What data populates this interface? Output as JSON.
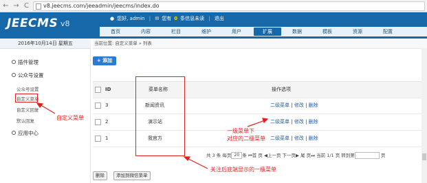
{
  "browser": {
    "back": "←",
    "forward": "→",
    "reload": "C",
    "url": "v8.jeecms.com/jeeadmin/jeecms/index.do"
  },
  "header": {
    "logo": "JEECMS",
    "version": "v8",
    "user": {
      "greeting": "您好, admin",
      "unread_prefix": "您有",
      "unread_count": "0",
      "unread_suffix": "条信息未读",
      "logout": "退出"
    },
    "nav": [
      "首页",
      "内容",
      "栏目",
      "维护",
      "用户",
      "扩展",
      "数据",
      "模板",
      "资源",
      "配置"
    ],
    "active_nav": "扩展"
  },
  "date": "2016年10月14日 星期五",
  "sidebar": {
    "groups": [
      {
        "label": "插件管理"
      },
      {
        "label": "公众号设置"
      },
      {
        "label": "应用中心"
      }
    ],
    "items": [
      "公众号设置",
      "自定义菜单",
      "自定义回复",
      "默认回复"
    ]
  },
  "breadcrumb": "当前位置: 自定义菜单 » 列表",
  "add_button": "+ 添加",
  "table": {
    "headers": {
      "id": "ID",
      "name": "菜单名称",
      "ops": "操作选项"
    },
    "rows": [
      {
        "id": "3",
        "name": "新闻资讯"
      },
      {
        "id": "2",
        "name": "演示站"
      },
      {
        "id": "1",
        "name": "我官方"
      }
    ],
    "ops": {
      "sub": "二级菜单",
      "sep": "|",
      "edit": "修改",
      "del": "删除"
    }
  },
  "pager": {
    "total": "共 3 条",
    "per_page": "每页",
    "per_page_value": "20",
    "per_page_unit": "条",
    "first": "首 页",
    "prev": "上一页",
    "next": "下一页",
    "last": "尾 页",
    "current": "当前 1/1 页",
    "goto": "转到第",
    "page_unit": "页"
  },
  "buttons": {
    "delete": "删除",
    "sync": "添加到微信菜单"
  },
  "annotations": {
    "custom_menu": "自定义菜单",
    "level1_line1": "一级菜单下",
    "level1_line2": "对应的二级菜单",
    "bottom": "关注后底端显示的一级菜单"
  },
  "colors": {
    "header": "#1668a8",
    "annotation": "#e02020",
    "link": "#1e5fb4",
    "add_button": "#2b7bd4"
  }
}
